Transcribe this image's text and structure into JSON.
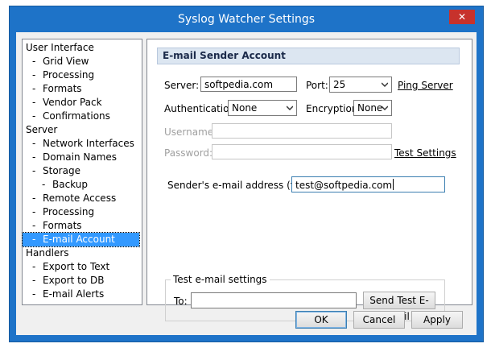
{
  "window": {
    "title": "Syslog Watcher Settings",
    "close_glyph": "✕"
  },
  "tree": {
    "items": [
      {
        "label": "User Interface",
        "level": 0
      },
      {
        "label": "Grid View",
        "level": 1
      },
      {
        "label": "Processing",
        "level": 1
      },
      {
        "label": "Formats",
        "level": 1
      },
      {
        "label": "Vendor Pack",
        "level": 1
      },
      {
        "label": "Confirmations",
        "level": 1
      },
      {
        "label": "Server",
        "level": 0
      },
      {
        "label": "Network Interfaces",
        "level": 1
      },
      {
        "label": "Domain Names",
        "level": 1
      },
      {
        "label": "Storage",
        "level": 1
      },
      {
        "label": "Backup",
        "level": 2
      },
      {
        "label": "Remote Access",
        "level": 1
      },
      {
        "label": "Processing",
        "level": 1
      },
      {
        "label": "Formats",
        "level": 1
      },
      {
        "label": "E-mail Account",
        "level": 1,
        "selected": true
      },
      {
        "label": "Handlers",
        "level": 0
      },
      {
        "label": "Export to Text",
        "level": 1
      },
      {
        "label": "Export to DB",
        "level": 1
      },
      {
        "label": "E-mail Alerts",
        "level": 1
      }
    ]
  },
  "panel": {
    "header": "E-mail Sender Account",
    "server_label": "Server:",
    "server_value": "softpedia.com",
    "port_label": "Port:",
    "port_value": "25",
    "ping_server": "Ping Server",
    "auth_label": "Authentication:",
    "auth_value": "None",
    "encryption_label": "Encryption:",
    "encryption_value": "None",
    "username_label": "Username:",
    "username_value": "",
    "password_label": "Password:",
    "password_value": "",
    "test_settings": "Test Settings",
    "from_label": "Sender's e-mail address (from):",
    "from_value": "test@softpedia.com",
    "test_group_title": "Test e-mail settings",
    "to_label": "To:",
    "to_value": "",
    "send_test": "Send Test E-mail"
  },
  "footer": {
    "ok": "OK",
    "cancel": "Cancel",
    "apply": "Apply"
  },
  "colors": {
    "title_bar": "#1e73c8",
    "close_button": "#c7322c",
    "selection": "#3399ff",
    "header_bg": "#dce6f1"
  },
  "icons": {
    "dropdown": "chevron-down-icon",
    "close": "close-icon"
  }
}
